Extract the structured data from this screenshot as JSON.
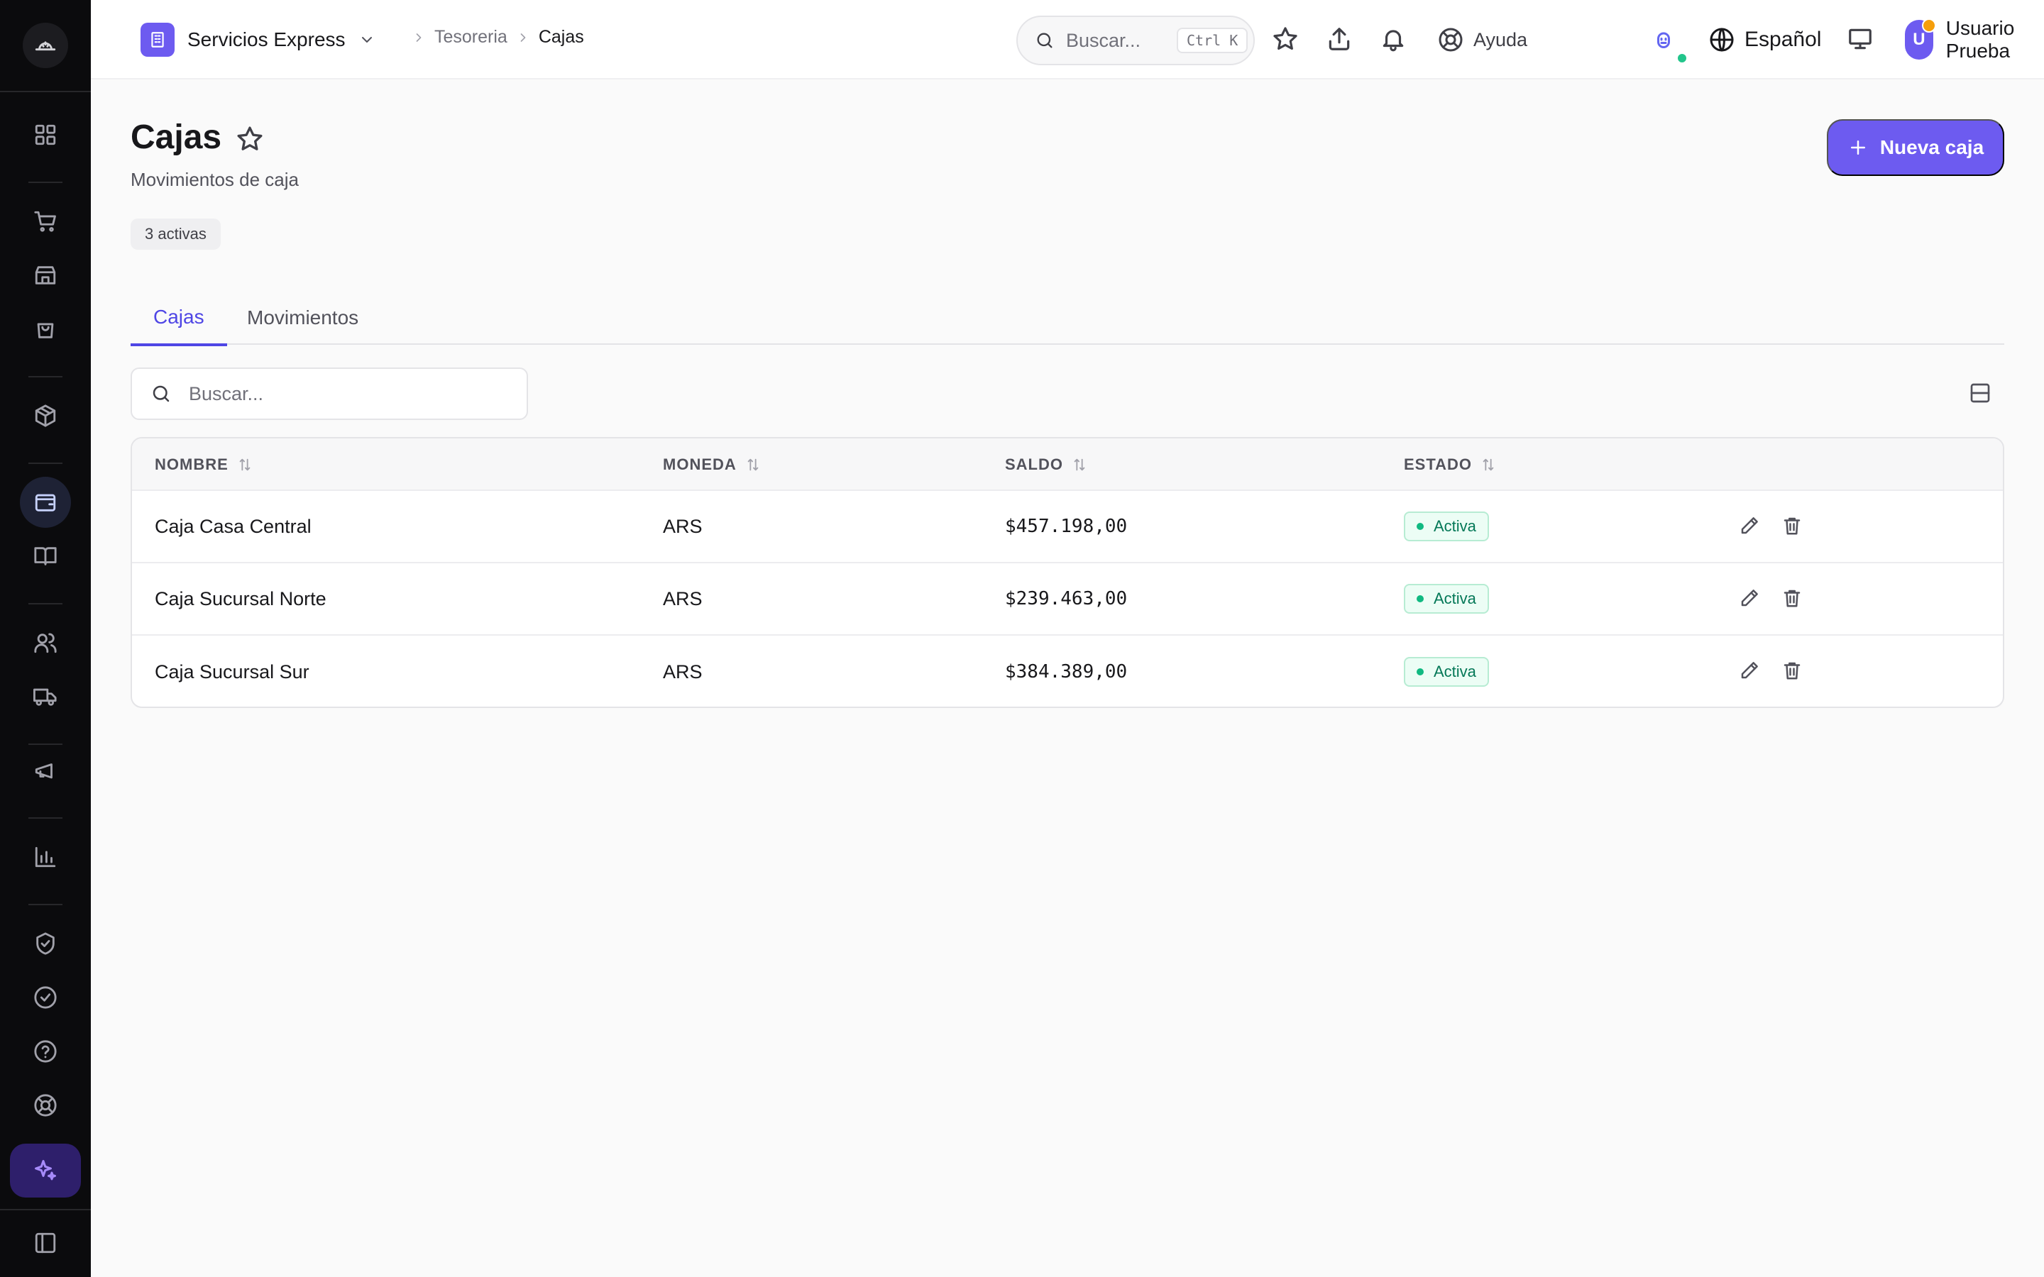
{
  "org": {
    "name": "Servicios Express"
  },
  "breadcrumb": {
    "items": [
      "Tesoreria",
      "Cajas"
    ]
  },
  "top_search": {
    "placeholder": "Buscar...",
    "shortcut": "Ctrl K"
  },
  "help": {
    "label": "Ayuda"
  },
  "language": {
    "label": "Español"
  },
  "user": {
    "initial": "U",
    "name": "Usuario Prueba"
  },
  "page": {
    "title": "Cajas",
    "subtitle": "Movimientos de caja",
    "active_count": "3 activas",
    "new_button": "Nueva caja"
  },
  "tabs": [
    {
      "label": "Cajas",
      "active": true
    },
    {
      "label": "Movimientos",
      "active": false
    }
  ],
  "table_search": {
    "placeholder": "Buscar..."
  },
  "table": {
    "columns": [
      "NOMBRE",
      "MONEDA",
      "SALDO",
      "ESTADO"
    ],
    "rows": [
      {
        "nombre": "Caja Casa Central",
        "moneda": "ARS",
        "saldo": "$457.198,00",
        "estado": "Activa"
      },
      {
        "nombre": "Caja Sucursal Norte",
        "moneda": "ARS",
        "saldo": "$239.463,00",
        "estado": "Activa"
      },
      {
        "nombre": "Caja Sucursal Sur",
        "moneda": "ARS",
        "saldo": "$384.389,00",
        "estado": "Activa"
      }
    ]
  },
  "sidebar": {
    "icons": [
      "dashboard-icon",
      "cart-icon",
      "store-icon",
      "shopping-bag-icon",
      "package-icon",
      "wallet-icon",
      "book-icon",
      "users-icon",
      "truck-icon",
      "megaphone-icon",
      "bar-chart-icon",
      "shield-check-icon",
      "check-circle-icon",
      "help-circle-icon",
      "life-buoy-icon",
      "sparkles-icon",
      "panel-left-icon"
    ]
  },
  "colors": {
    "accent": "#6d5bf0",
    "sidebar_bg": "#0b0b0d",
    "status_green": "#10b981"
  }
}
